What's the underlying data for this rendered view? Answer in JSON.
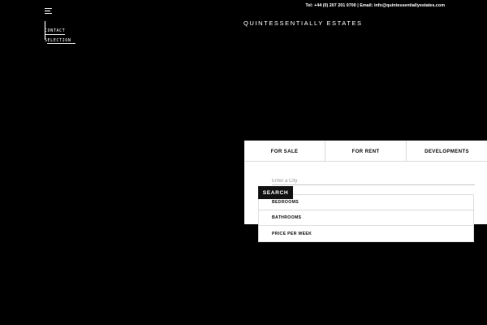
{
  "header": {
    "contact_bar": "Tel: +44 (0) 207 201 0700 | Email: info@quintessentiallyestates.com",
    "brand": "QUINTESSENTIALLY ESTATES"
  },
  "side_nav": {
    "contact_label": "CONTACT",
    "selection_label": "SELECTION"
  },
  "search_panel": {
    "tabs": [
      {
        "label": "FOR SALE"
      },
      {
        "label": "FOR RENT"
      },
      {
        "label": "DEVELOPMENTS"
      }
    ],
    "city_placeholder": "Enter a City",
    "search_label": "SEARCH",
    "filters": [
      {
        "label": "BEDROOMS"
      },
      {
        "label": "BATHROOMS"
      },
      {
        "label": "PRICE PER WEEK"
      }
    ]
  }
}
